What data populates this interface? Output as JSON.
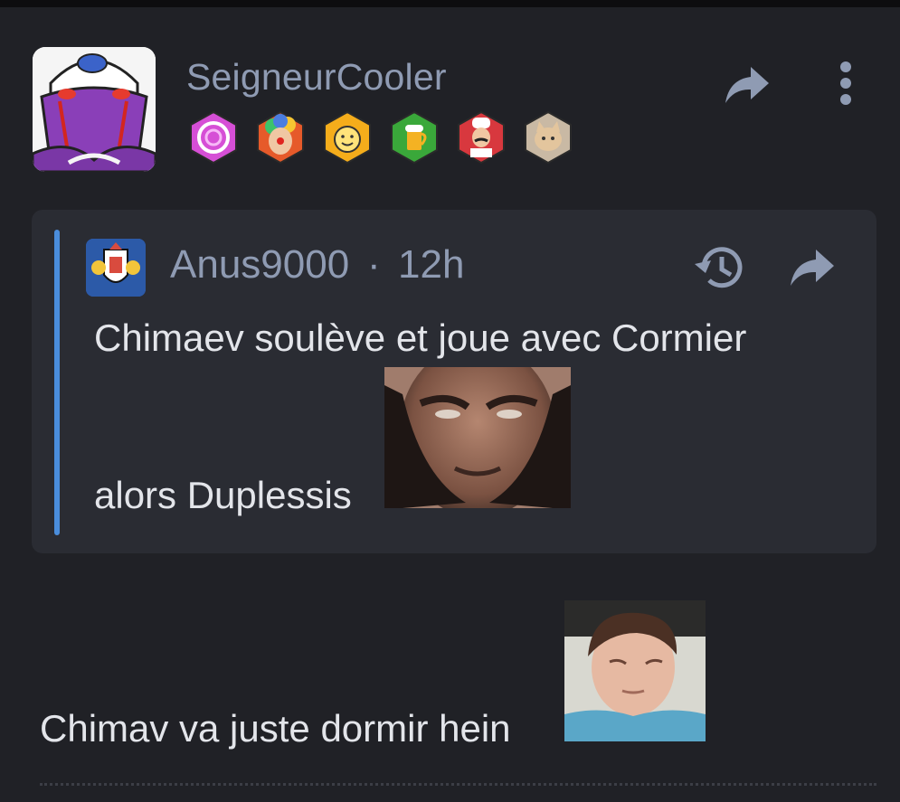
{
  "post": {
    "author": "SeigneurCooler",
    "avatar_icon": "purple-alien-avatar-icon",
    "badges": [
      {
        "name": "purple-swirl-badge-icon",
        "color": "#c23ccf"
      },
      {
        "name": "clown-badge-icon",
        "color": "#e9572b"
      },
      {
        "name": "smiley-hands-badge-icon",
        "color": "#f2a81d"
      },
      {
        "name": "beer-badge-icon",
        "color": "#3fae3c"
      },
      {
        "name": "chef-badge-icon",
        "color": "#d8383e"
      },
      {
        "name": "cat-badge-icon",
        "color": "#c9b9a4"
      }
    ],
    "text": "Chimav va juste dormir hein",
    "image_icon": "sleeping-child-sticker-icon"
  },
  "quote": {
    "author": "Anus9000",
    "separator": "·",
    "time": "12h",
    "avatar_icon": "coat-of-arms-icon",
    "line1": "Chimaev soulève et joue avec Cormier",
    "line2": "alors Duplessis",
    "image_icon": "menacing-face-sticker-icon"
  },
  "colors": {
    "background": "#202126",
    "quote_background": "#2a2c33",
    "quote_accent": "#4a8ddc",
    "muted_text": "#8f9bb3",
    "text": "#e3e5ea"
  }
}
